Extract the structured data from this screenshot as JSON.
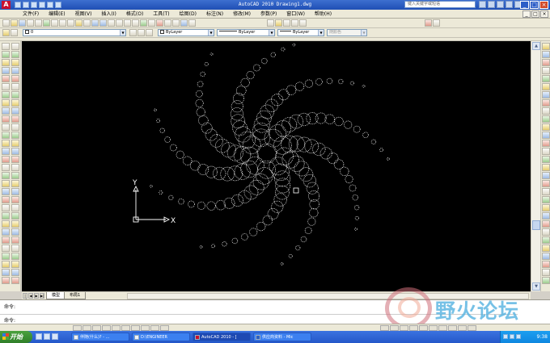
{
  "window": {
    "title": "AutoCAD 2010  Drawing1.dwg",
    "search_placeholder": "键入关键字或短语"
  },
  "menu": {
    "items": [
      "文件(F)",
      "编辑(E)",
      "视图(V)",
      "插入(I)",
      "格式(O)",
      "工具(T)",
      "绘图(D)",
      "标注(N)",
      "修改(M)",
      "参数(P)",
      "窗口(W)",
      "帮助(H)"
    ]
  },
  "properties": {
    "layer": "0",
    "color": "ByLayer",
    "linetype": "ByLayer",
    "lineweight": "ByLayer",
    "plotstyle": "随颜色"
  },
  "tabs": {
    "model": "模型",
    "layout1": "布局1"
  },
  "ucs": {
    "x_label": "X",
    "y_label": "Y"
  },
  "command": {
    "line1": "命令:",
    "line2": "命令:"
  },
  "watermark": {
    "text": "野火论坛"
  },
  "taskbar": {
    "start": "开始",
    "tasks": [
      "伴随(什么)? - ...",
      "D:\\ENGINEER",
      "AutoCAD 2010 - [",
      "供应商资料 - Mic"
    ],
    "clock": "9:38"
  },
  "colors": {
    "canvas_bg": "#000000",
    "geometry": "#ffffff",
    "title_bar": "#2a5cc3",
    "taskbar": "#2d62d6"
  }
}
